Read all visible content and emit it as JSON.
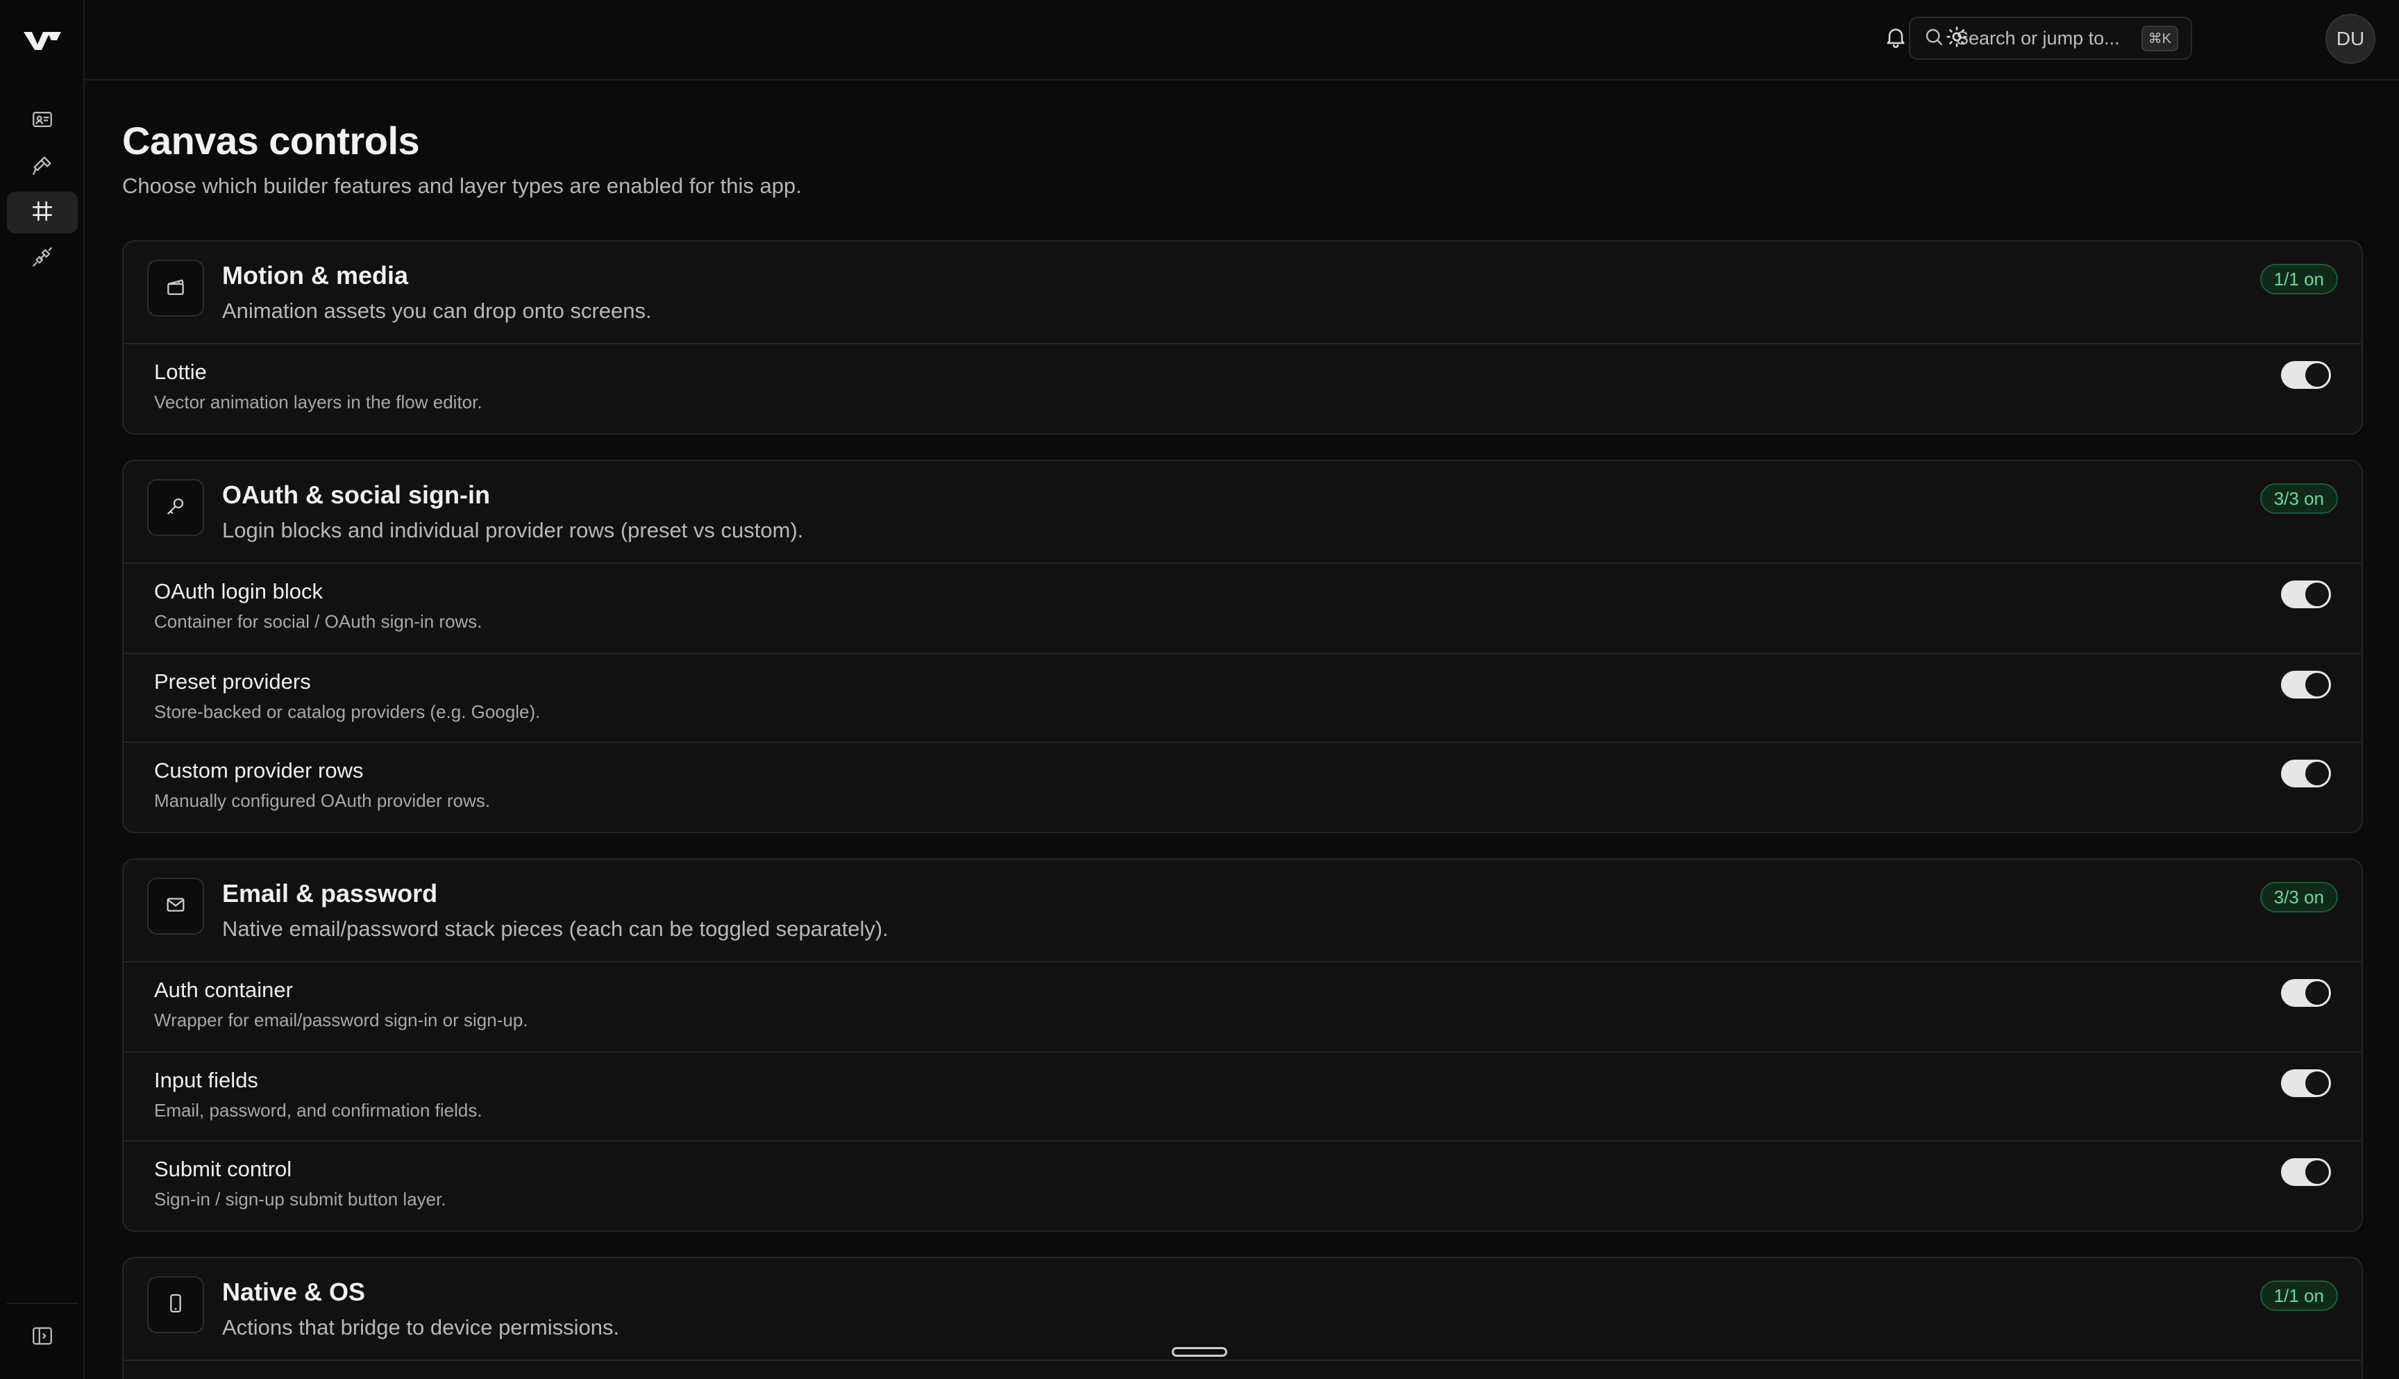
{
  "header": {
    "search_placeholder": "Search or jump to...",
    "search_shortcut": "⌘K",
    "avatar_initials": "DU"
  },
  "sidebar": {
    "items": [
      {
        "icon": "id-card-icon"
      },
      {
        "icon": "hammer-icon"
      },
      {
        "icon": "hash-grid-icon",
        "active": true
      },
      {
        "icon": "plug-icon"
      }
    ],
    "footer_icon": "sidebar-toggle-icon"
  },
  "page": {
    "title": "Canvas controls",
    "subtitle": "Choose which builder features and layer types are enabled for this app."
  },
  "sections": [
    {
      "icon": "clapperboard-icon",
      "title": "Motion & media",
      "description": "Animation assets you can drop onto screens.",
      "badge": "1/1 on",
      "rows": [
        {
          "title": "Lottie",
          "description": "Vector animation layers in the flow editor.",
          "enabled": true
        }
      ]
    },
    {
      "icon": "key-icon",
      "title": "OAuth & social sign-in",
      "description": "Login blocks and individual provider rows (preset vs custom).",
      "badge": "3/3 on",
      "rows": [
        {
          "title": "OAuth login block",
          "description": "Container for social / OAuth sign-in rows.",
          "enabled": true
        },
        {
          "title": "Preset providers",
          "description": "Store-backed or catalog providers (e.g. Google).",
          "enabled": true
        },
        {
          "title": "Custom provider rows",
          "description": "Manually configured OAuth provider rows.",
          "enabled": true
        }
      ]
    },
    {
      "icon": "mail-icon",
      "title": "Email & password",
      "description": "Native email/password stack pieces (each can be toggled separately).",
      "badge": "3/3 on",
      "rows": [
        {
          "title": "Auth container",
          "description": "Wrapper for email/password sign-in or sign-up.",
          "enabled": true
        },
        {
          "title": "Input fields",
          "description": "Email, password, and confirmation fields.",
          "enabled": true
        },
        {
          "title": "Submit control",
          "description": "Sign-in / sign-up submit button layer.",
          "enabled": true
        }
      ]
    },
    {
      "icon": "smartphone-icon",
      "title": "Native & OS",
      "description": "Actions that bridge to device permissions.",
      "badge": "1/1 on",
      "rows": []
    }
  ],
  "colors": {
    "background": "#0b0b0b",
    "card": "#111111",
    "badge_text": "#6fd99b",
    "badge_bg": "#0f2a1b"
  }
}
